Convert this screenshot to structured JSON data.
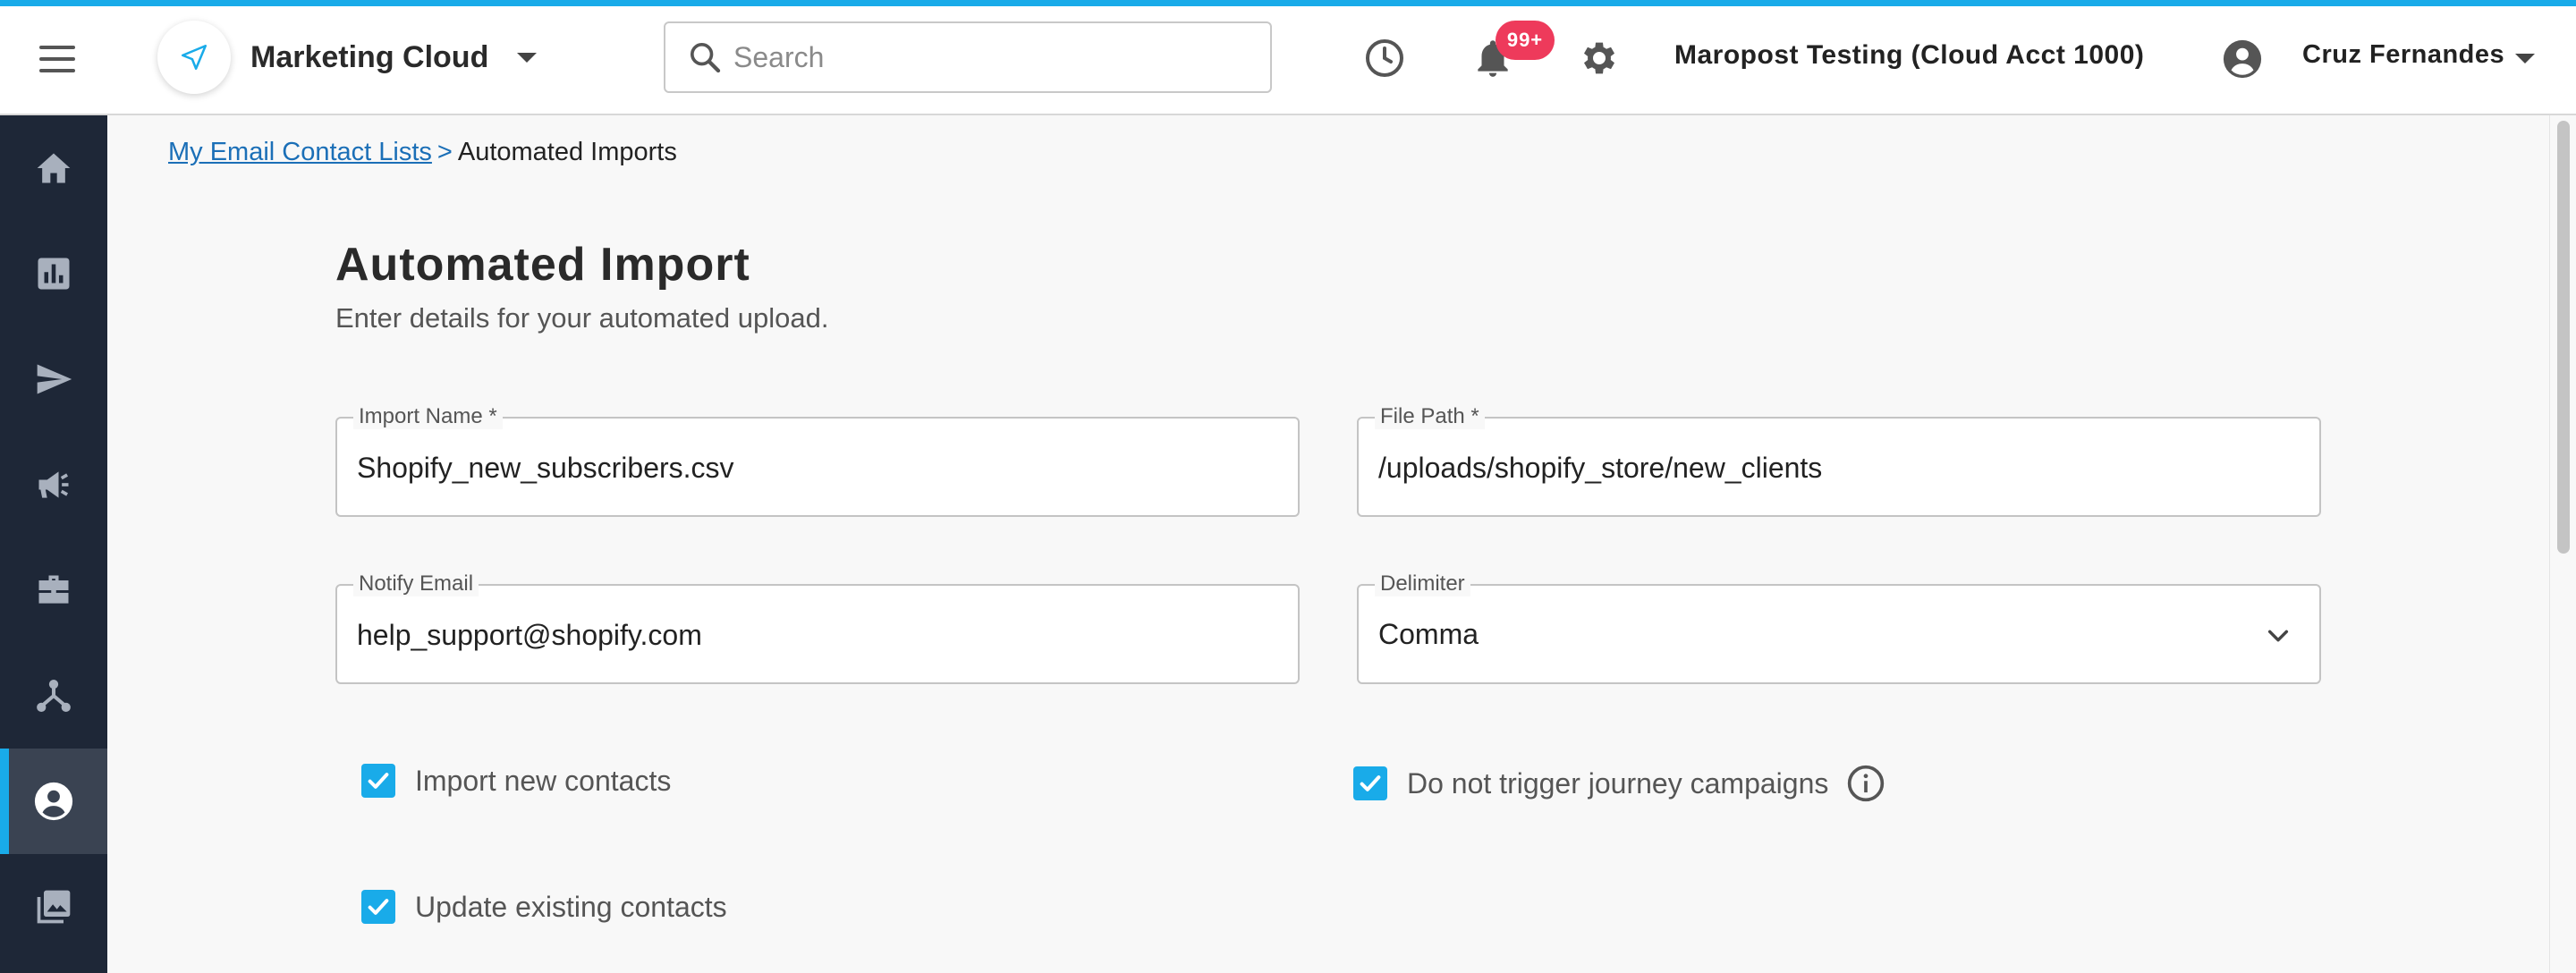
{
  "header": {
    "app_name": "Marketing Cloud",
    "search_placeholder": "Search",
    "notifications_badge": "99+",
    "account_name": "Maropost Testing (Cloud Acct 1000)",
    "user_name": "Cruz Fernandes"
  },
  "sidebar": {
    "items": [
      {
        "icon": "home-icon"
      },
      {
        "icon": "reports-icon"
      },
      {
        "icon": "send-icon"
      },
      {
        "icon": "campaign-megaphone-icon"
      },
      {
        "icon": "briefcase-icon"
      },
      {
        "icon": "journey-icon"
      },
      {
        "icon": "contacts-icon",
        "active": true
      },
      {
        "icon": "content-library-icon"
      }
    ]
  },
  "breadcrumb": {
    "parent": "My Email Contact Lists",
    "separator": ">",
    "current": "Automated Imports"
  },
  "page": {
    "title": "Automated Import",
    "subtitle": "Enter details for your automated upload."
  },
  "form": {
    "import_name": {
      "label": "Import Name *",
      "value": "Shopify_new_subscribers.csv"
    },
    "file_path": {
      "label": "File Path *",
      "value": "/uploads/shopify_store/new_clients"
    },
    "notify_email": {
      "label": "Notify Email",
      "value": "help_support@shopify.com"
    },
    "delimiter": {
      "label": "Delimiter",
      "value": "Comma"
    },
    "checkboxes": {
      "import_new": {
        "label": "Import new contacts",
        "checked": true
      },
      "no_journey": {
        "label": "Do not trigger journey campaigns",
        "checked": true
      },
      "update_existing": {
        "label": "Update existing contacts",
        "checked": true
      }
    }
  },
  "colors": {
    "accent": "#19abe9",
    "sidebar": "#1e2737",
    "badge": "#ee3a5b",
    "link": "#1b6fb7"
  }
}
